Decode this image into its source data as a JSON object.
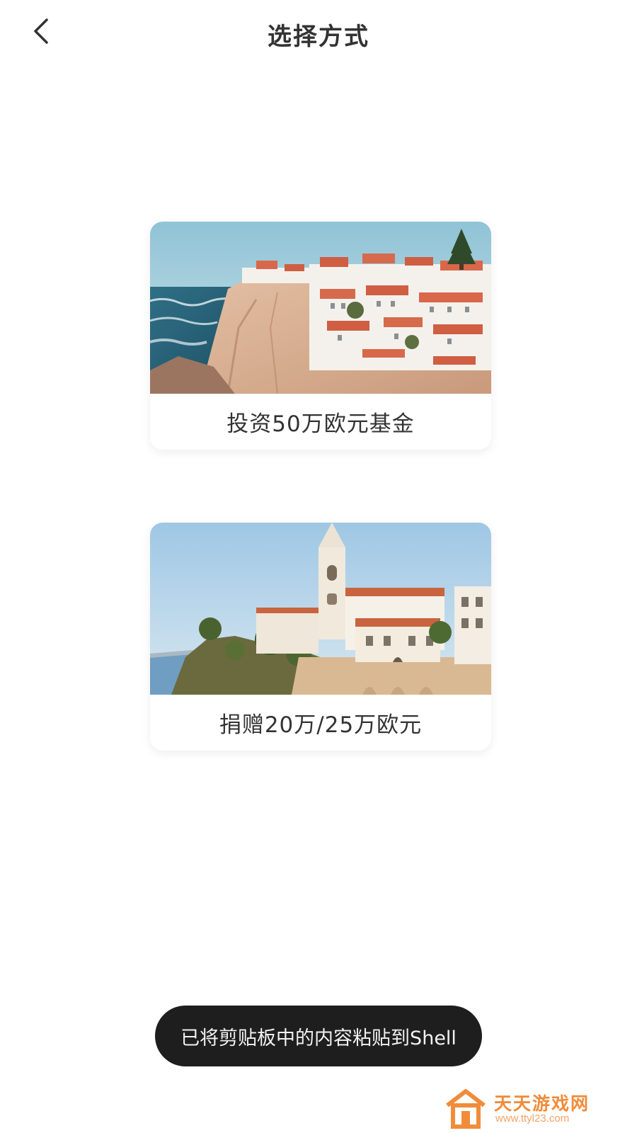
{
  "header": {
    "title": "选择方式",
    "back_icon": "chevron-left-icon"
  },
  "options": [
    {
      "label": "投资50万欧元基金",
      "image": "cliffside-town-photo"
    },
    {
      "label": "捐赠20万/25万欧元",
      "image": "church-town-photo"
    }
  ],
  "toast": {
    "message": "已将剪贴板中的内容粘贴到Shell"
  },
  "watermark": {
    "title": "天天游戏网",
    "url": "www.ttyl23.com"
  },
  "colors": {
    "title": "#333333",
    "toast_bg": "#1e1e1e",
    "watermark": "#f08c3a"
  }
}
